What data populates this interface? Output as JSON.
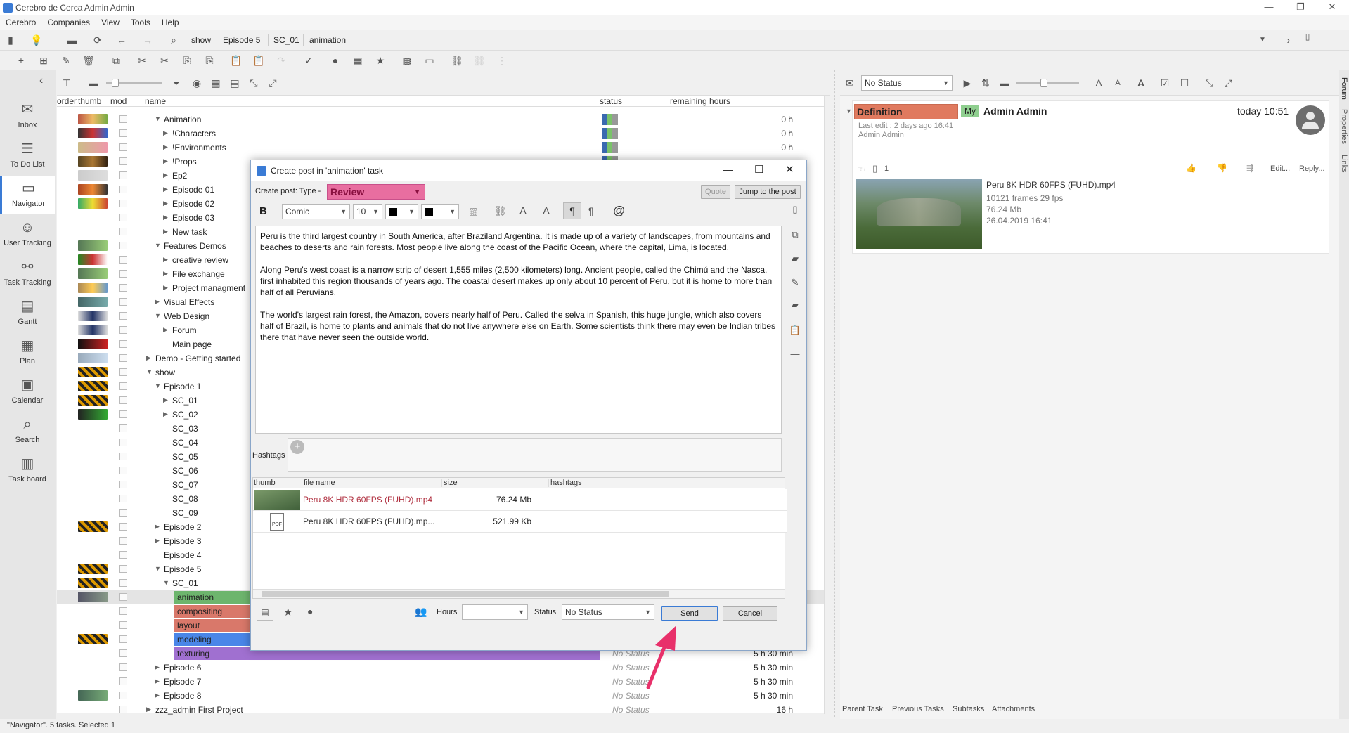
{
  "window": {
    "title": "Cerebro de Cerca  Admin Admin"
  },
  "menu": [
    "Cerebro",
    "Companies",
    "View",
    "Tools",
    "Help"
  ],
  "breadcrumb": [
    "show",
    "Episode 5",
    "SC_01",
    "animation"
  ],
  "nav": [
    {
      "label": "Inbox",
      "icon": "inbox-icon",
      "glyph": "✉"
    },
    {
      "label": "To Do List",
      "icon": "todo-list-icon",
      "glyph": "☰"
    },
    {
      "label": "Navigator",
      "icon": "navigator-icon",
      "glyph": "▭"
    },
    {
      "label": "User Tracking",
      "icon": "user-tracking-icon",
      "glyph": "☺"
    },
    {
      "label": "Task Tracking",
      "icon": "task-tracking-icon",
      "glyph": "⚯"
    },
    {
      "label": "Gantt",
      "icon": "gantt-icon",
      "glyph": "▤"
    },
    {
      "label": "Plan",
      "icon": "plan-icon",
      "glyph": "▦"
    },
    {
      "label": "Calendar",
      "icon": "calendar-icon",
      "glyph": "▣"
    },
    {
      "label": "Search",
      "icon": "search-icon",
      "glyph": "⌕"
    },
    {
      "label": "Task board",
      "icon": "task-board-icon",
      "glyph": "▥"
    }
  ],
  "tree": {
    "headers": {
      "order": "order",
      "thumb": "thumb",
      "mod": "mod",
      "name": "name",
      "status": "status",
      "remaining": "remaining hours"
    },
    "rows": [
      {
        "name": "Animation",
        "level": 1,
        "open": true,
        "thumb": "t1",
        "hours": "0 h"
      },
      {
        "name": "!Characters",
        "level": 2,
        "thumb": "t2",
        "hours": "0 h"
      },
      {
        "name": "!Environments",
        "level": 2,
        "thumb": "t3",
        "hours": "0 h"
      },
      {
        "name": "!Props",
        "level": 2,
        "thumb": "t4",
        "hours": ""
      },
      {
        "name": "Ep2",
        "level": 2,
        "thumb": "t5",
        "hours": ""
      },
      {
        "name": "Episode 01",
        "level": 2,
        "thumb": "t6",
        "hours": ""
      },
      {
        "name": "Episode 02",
        "level": 2,
        "thumb": "t7",
        "hours": ""
      },
      {
        "name": "Episode 03",
        "level": 2,
        "thumb": "",
        "hours": ""
      },
      {
        "name": "New task",
        "level": 2,
        "thumb": "",
        "hours": ""
      },
      {
        "name": "Features Demos",
        "level": 1,
        "open": true,
        "thumb": "t8",
        "hours": ""
      },
      {
        "name": "creative review",
        "level": 2,
        "thumb": "t9",
        "hours": ""
      },
      {
        "name": "File exchange",
        "level": 2,
        "thumb": "t8",
        "hours": ""
      },
      {
        "name": "Project managment",
        "level": 2,
        "thumb": "t10",
        "hours": ""
      },
      {
        "name": "Visual Effects",
        "level": 1,
        "thumb": "t11",
        "hours": ""
      },
      {
        "name": "Web Design",
        "level": 1,
        "open": true,
        "thumb": "t12",
        "hours": ""
      },
      {
        "name": "Forum",
        "level": 2,
        "thumb": "t12",
        "hours": ""
      },
      {
        "name": "Main page",
        "level": 2,
        "leaf": true,
        "thumb": "t13",
        "hours": ""
      },
      {
        "name": "Demo - Getting started",
        "level": 0,
        "thumb": "t14",
        "hours": ""
      },
      {
        "name": "show",
        "level": 0,
        "open": true,
        "thumb": "tx",
        "hours": ""
      },
      {
        "name": "Episode 1",
        "level": 1,
        "open": true,
        "thumb": "tx",
        "hours": ""
      },
      {
        "name": "SC_01",
        "level": 2,
        "thumb": "tx",
        "hours": ""
      },
      {
        "name": "SC_02",
        "level": 2,
        "thumb": "t15",
        "hours": ""
      },
      {
        "name": "SC_03",
        "level": 2,
        "leaf": true,
        "thumb": "",
        "hours": ""
      },
      {
        "name": "SC_04",
        "level": 2,
        "leaf": true,
        "thumb": "",
        "hours": ""
      },
      {
        "name": "SC_05",
        "level": 2,
        "leaf": true,
        "thumb": "",
        "hours": ""
      },
      {
        "name": "SC_06",
        "level": 2,
        "leaf": true,
        "thumb": "",
        "hours": ""
      },
      {
        "name": "SC_07",
        "level": 2,
        "leaf": true,
        "thumb": "",
        "hours": ""
      },
      {
        "name": "SC_08",
        "level": 2,
        "leaf": true,
        "thumb": "",
        "hours": ""
      },
      {
        "name": "SC_09",
        "level": 2,
        "leaf": true,
        "thumb": "",
        "hours": ""
      },
      {
        "name": "Episode 2",
        "level": 1,
        "thumb": "tx",
        "hours": ""
      },
      {
        "name": "Episode 3",
        "level": 1,
        "thumb": "",
        "hours": ""
      },
      {
        "name": "Episode 4",
        "level": 1,
        "leaf": true,
        "thumb": "",
        "hours": ""
      },
      {
        "name": "Episode 5",
        "level": 1,
        "open": true,
        "thumb": "tx",
        "hours": ""
      },
      {
        "name": "SC_01",
        "level": 2,
        "open": true,
        "thumb": "tx",
        "hours": ""
      },
      {
        "name": "animation",
        "level": 3,
        "task": "#6db56d",
        "selected": true,
        "thumb": "t16",
        "hours": ""
      },
      {
        "name": "compositing",
        "level": 3,
        "task": "#d9786a",
        "thumb": "",
        "hours": ""
      },
      {
        "name": "layout",
        "level": 3,
        "task": "#d9786a",
        "thumb": "",
        "hours": ""
      },
      {
        "name": "modeling",
        "level": 3,
        "task": "#4a86e8",
        "thumb": "tx",
        "hours": ""
      },
      {
        "name": "texturing",
        "level": 3,
        "task": "#a070d0",
        "thumb": "",
        "status": "No Status",
        "hours": "5 h 30 min"
      },
      {
        "name": "Episode 6",
        "level": 1,
        "thumb": "",
        "status": "No Status",
        "hours": "5 h 30 min"
      },
      {
        "name": "Episode 7",
        "level": 1,
        "thumb": "",
        "status": "No Status",
        "hours": "5 h 30 min"
      },
      {
        "name": "Episode 8",
        "level": 1,
        "thumb": "t17",
        "status": "No Status",
        "hours": "5 h 30 min"
      },
      {
        "name": "zzz_admin First Project",
        "level": 0,
        "thumb": "",
        "status": "No Status",
        "hours": "16 h"
      }
    ]
  },
  "dialog": {
    "title": "Create post in 'animation' task",
    "type_label": "Create post: Type -",
    "type_value": "Review",
    "quote": "Quote",
    "jump": "Jump to the post",
    "font": "Comic",
    "font_size": "10",
    "paragraphs": [
      "Peru is the third largest country in South America, after Braziland Argentina. It is made up of a variety of landscapes, from mountains and beaches to deserts and rain forests. Most people live along the coast of the Pacific Ocean, where the capital, Lima, is located.",
      "Along Peru's west coast is a narrow strip of desert 1,555 miles (2,500 kilometers) long. Ancient people, called the Chimú and the Nasca, first inhabited this region thousands of years ago. The coastal desert makes up only about 10 percent of Peru, but it is home to more than half of all Peruvians.",
      "The world's largest rain forest, the Amazon, covers nearly half of Peru. Called the selva in Spanish, this huge jungle, which also covers half of Brazil, is home to plants and animals that do not live anywhere else on Earth. Some scientists think there may even be Indian tribes there that have never seen the outside world."
    ],
    "hashtags_label": "Hashtags",
    "files_headers": {
      "thumb": "thumb",
      "name": "file name",
      "size": "size",
      "hashtags": "hashtags"
    },
    "files": [
      {
        "name": "Peru 8K HDR 60FPS (FUHD).mp4",
        "size": "76.24 Mb",
        "highlight": true
      },
      {
        "name": "Peru 8K HDR 60FPS (FUHD).mp...",
        "size": "521.99 Kb",
        "highlight": false
      }
    ],
    "hours_label": "Hours",
    "status_label": "Status",
    "status_value": "No Status",
    "send": "Send",
    "cancel": "Cancel",
    "pdf_label": "PDF"
  },
  "right": {
    "status_filter": "No Status",
    "post": {
      "type": "Definition",
      "my": "My",
      "author": "Admin Admin",
      "time": "today 10:51",
      "last_edit": "Last edit : 2 days ago 16:41",
      "last_editor": "Admin Admin",
      "attach_count": "1",
      "edit": "Edit...",
      "reply": "Reply...",
      "file_name": "Peru 8K HDR 60FPS (FUHD).mp4",
      "frames": "10121 frames 29 fps",
      "size": "76.24 Mb",
      "date": "26.04.2019 16:41"
    },
    "bottom_tabs": [
      "Parent Task",
      "Previous Tasks",
      "Subtasks",
      "Attachments"
    ],
    "side_tabs": [
      "Forum",
      "Properties",
      "Links"
    ]
  },
  "statusbar": {
    "text": "\"Navigator\". 5 tasks. Selected 1"
  },
  "colors": {
    "accent": "#3a7bd5",
    "review": "#e86ea0",
    "definition": "#e07a5f",
    "send_arrow": "#e8306a"
  }
}
